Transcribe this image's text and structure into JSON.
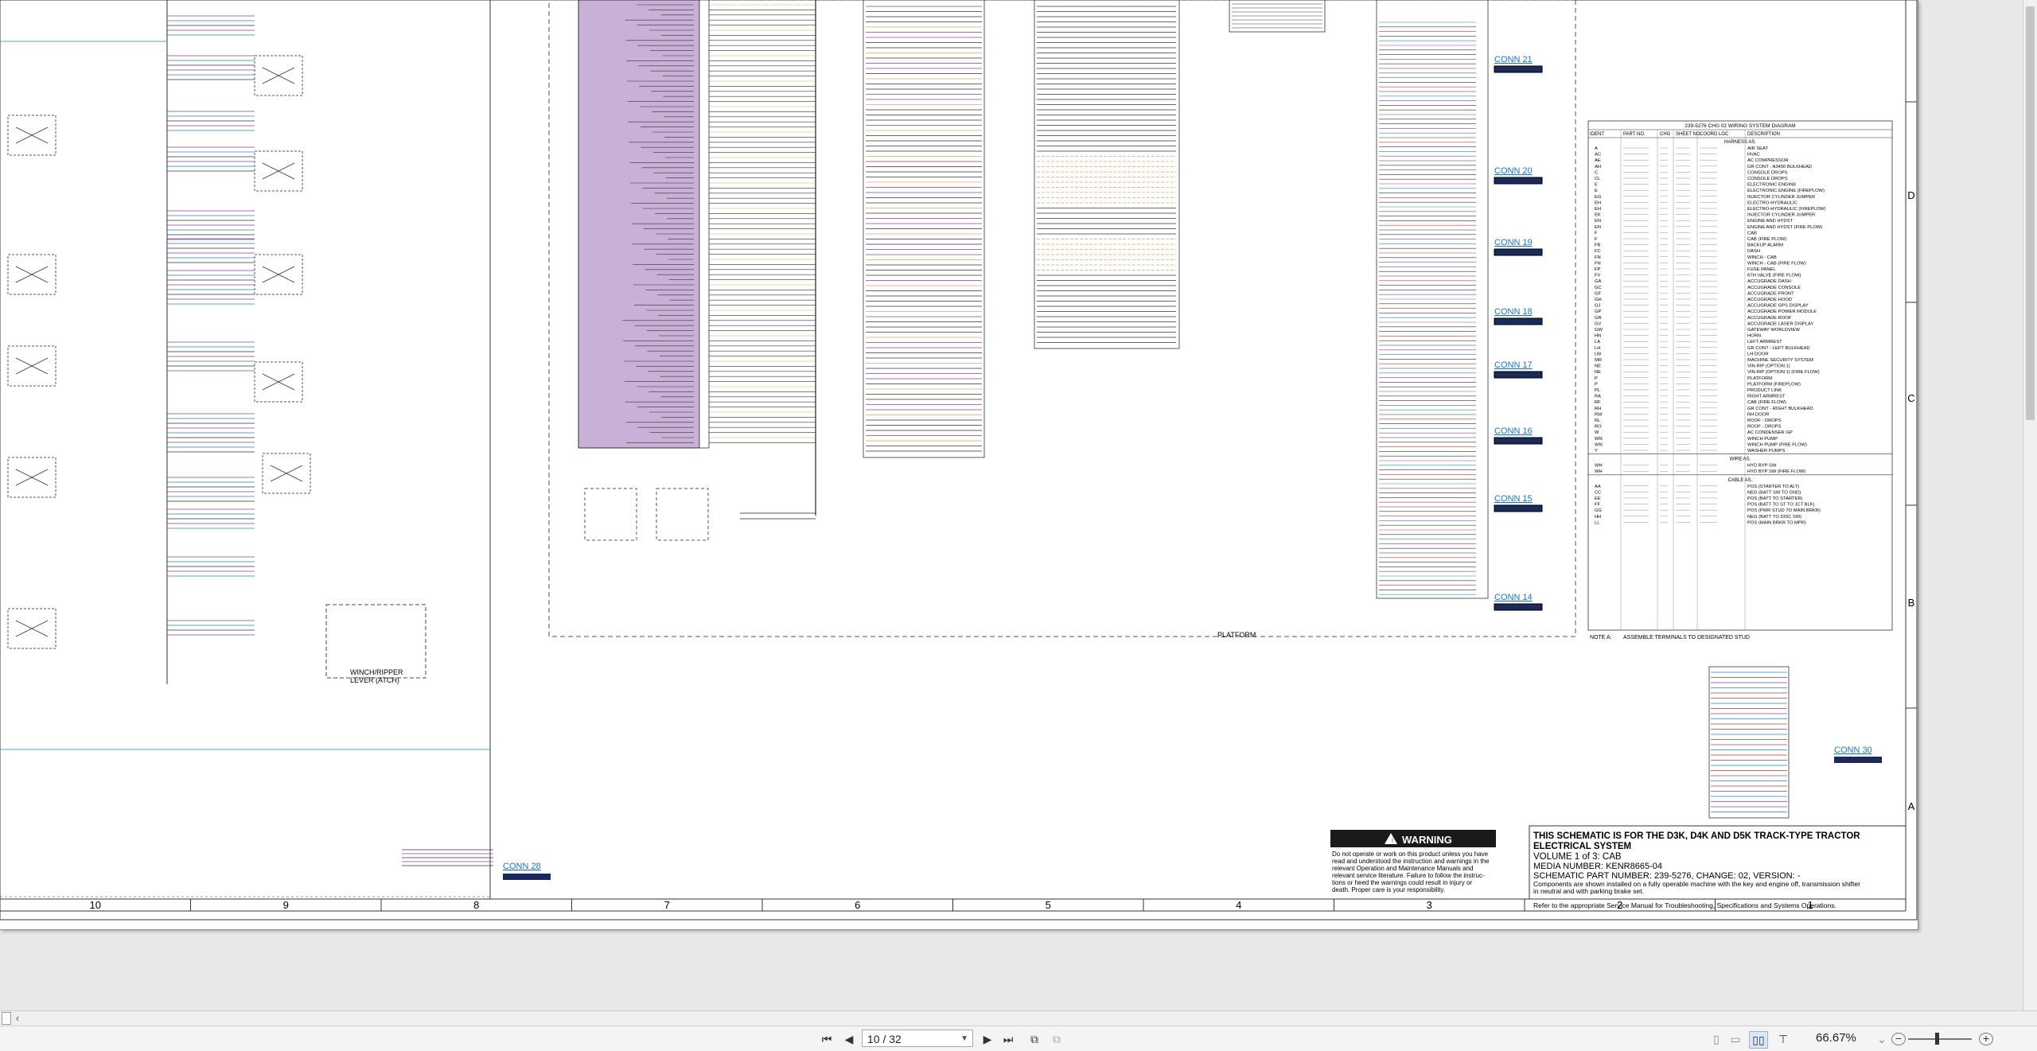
{
  "document": {
    "notice": {
      "line1": "THIS SCHEMATIC IS FOR THE D3K, D4K AND D5K TRACK-TYPE TRACTOR",
      "line2": "ELECTRICAL SYSTEM",
      "line3": "VOLUME 1 of 3: CAB",
      "line4": "MEDIA NUMBER: KENR8665-04",
      "line5": "SCHEMATIC PART NUMBER: 239-5276, CHANGE: 02, VERSION: -",
      "line6": "Components are shown installed on a fully operable machine with the key and engine off, transmission shifter",
      "line7": "in neutral and with parking brake set.",
      "line8": "Refer to the appropriate Service Manual for Troubleshooting, Specifications and Systems Operations."
    },
    "warning": {
      "title": "WARNING",
      "body1": "Do not operate or work on this product unless you have",
      "body2": "read and understood the instruction and warnings in the",
      "body3": "relevant Operation and Maintenance Manuals and",
      "body4": "relevant service literature. Failure to follow the instruc-",
      "body5": "tions or heed the warnings could result in injury or",
      "body6": "death. Proper care is your responsibility."
    },
    "column_numbers": [
      "10",
      "9",
      "8",
      "7",
      "6",
      "5",
      "4",
      "3",
      "2",
      "1"
    ],
    "row_letters": [
      "D",
      "C",
      "B",
      "A"
    ],
    "platform_label": "PLATFORM",
    "winch_label_1": "WINCH/RIPPER",
    "winch_label_2": "LEVER (ATCH)",
    "note_a": "NOTE A:",
    "note_a_text": "ASSEMBLE TERMINALS TO DESIGNATED STUD",
    "connectors": [
      {
        "id": "c21",
        "label": "CONN 21"
      },
      {
        "id": "c20",
        "label": "CONN 20"
      },
      {
        "id": "c19",
        "label": "CONN 19"
      },
      {
        "id": "c18",
        "label": "CONN 18"
      },
      {
        "id": "c17",
        "label": "CONN 17"
      },
      {
        "id": "c16",
        "label": "CONN 16"
      },
      {
        "id": "c15",
        "label": "CONN 15"
      },
      {
        "id": "c14",
        "label": "CONN 14"
      },
      {
        "id": "c30",
        "label": "CONN 30"
      },
      {
        "id": "c28",
        "label": "CONN 28"
      }
    ],
    "harness_table": {
      "title": "239-5276 CHG 02 WIRING SYSTEM DIAGRAM",
      "headers": [
        "IDENT",
        "PART NO.",
        "CHG",
        "SHEET NO.",
        "COORD LOC",
        "DESCRIPTION"
      ],
      "section_harness": "HARNESS AS.",
      "section_wire": "WIRE AS.",
      "section_cable": "CABLE AS.",
      "harness_rows": [
        [
          "A",
          "AIR SEAT"
        ],
        [
          "AC",
          "HVAC"
        ],
        [
          "AE",
          "AC COMPRESSOR"
        ],
        [
          "AH",
          "GR CONT - A3400 BULKHEAD"
        ],
        [
          "C",
          "CONSOLE DROPS"
        ],
        [
          "CL",
          "CONSOLE DROPS"
        ],
        [
          "E",
          "ELECTRONIC ENGINE"
        ],
        [
          "E",
          "ELECTRONIC ENGINE (FIREPLOW)"
        ],
        [
          "EG",
          "INJECTOR CYLINDER JUMPER"
        ],
        [
          "EH",
          "ELECTRO-HYDRAULIC"
        ],
        [
          "EH",
          "ELECTRO-HYDRAULIC (FIREPLOW)"
        ],
        [
          "EK",
          "INJECTOR CYLINDER JUMPER"
        ],
        [
          "EN",
          "ENGINE AND HYDST"
        ],
        [
          "EN",
          "ENGINE AND HYDST (FIRE PLOW)"
        ],
        [
          "F",
          "CAB"
        ],
        [
          "F",
          "CAB (FIRE PLOW)"
        ],
        [
          "FB",
          "BACKUP ALARM"
        ],
        [
          "FC",
          "DASH"
        ],
        [
          "FN",
          "WINCH - CAB"
        ],
        [
          "FN",
          "WINCH - CAB (FIRE FLOW)"
        ],
        [
          "FP",
          "FUSE PANEL"
        ],
        [
          "FV",
          "6TH VALVE (FIRE FLOW)"
        ],
        [
          "GA",
          "ACCUGRADE DASH"
        ],
        [
          "GC",
          "ACCUGRADE CONSOLE"
        ],
        [
          "GF",
          "ACCUGRADE FRONT"
        ],
        [
          "GH",
          "ACCUGRADE HOOD"
        ],
        [
          "GJ",
          "ACCUGRADE GPS DISPLAY"
        ],
        [
          "GP",
          "ACCUGRADE POWER MODULE"
        ],
        [
          "GR",
          "ACCUGRADE ROOF"
        ],
        [
          "GV",
          "ACCUGRADE LASER DISPLAY"
        ],
        [
          "GW",
          "GATEWAY WORLDVIEW"
        ],
        [
          "HN",
          "HORN"
        ],
        [
          "LA",
          "LEFT ARMREST"
        ],
        [
          "LH",
          "GR CONT - LEFT BULKHEAD"
        ],
        [
          "LW",
          "LH DOOR"
        ],
        [
          "MR",
          "MACHINE SECURITY SYSTEM"
        ],
        [
          "NE",
          "VIN-RIP (OPTION 1)"
        ],
        [
          "NE",
          "VIN-RIP (OPTION 1) (FIRE FLOW)"
        ],
        [
          "P",
          "PLATFORM"
        ],
        [
          "P",
          "PLATFORM (FIREPLOW)"
        ],
        [
          "PL",
          "PRODUCT LINK"
        ],
        [
          "RA",
          "RIGHT ARMREST"
        ],
        [
          "RF",
          "CAB (FIRE FLOW)"
        ],
        [
          "RH",
          "GR CONT - RIGHT BULKHEAD"
        ],
        [
          "RW",
          "RH DOOR"
        ],
        [
          "RL",
          "ROOF - DROPS"
        ],
        [
          "RO",
          "ROOF - DROPS"
        ],
        [
          "W",
          "AC CONDENSER GP"
        ],
        [
          "WN",
          "WINCH PUMP"
        ],
        [
          "WN",
          "WINCH PUMP (FIRE FLOW)"
        ],
        [
          "Y",
          "WASHER PUMPS"
        ]
      ],
      "wire_rows": [
        [
          "WH",
          "HYD BYP SW"
        ],
        [
          "WH",
          "HYD BYP SW (FIRE FLOW)"
        ]
      ],
      "cable_rows": [
        [
          "AA",
          "POS (STARTER TO ALT)"
        ],
        [
          "CC",
          "NEG (BATT SW TO GND)"
        ],
        [
          "EE",
          "POS (BATT TO STARTER)"
        ],
        [
          "FF",
          "POS (BATT TO ST TO JCT BLK)"
        ],
        [
          "GG",
          "POS (PWR STUD TO MAIN BRKR)"
        ],
        [
          "HH",
          "NEG (BATT TO DISC SW)"
        ],
        [
          "LL",
          "POS (MAIN BRKR TO MPR)"
        ]
      ]
    }
  },
  "viewer": {
    "page_indicator": "10 / 32",
    "zoom": "66.67%",
    "colors": {
      "purple_block": "#c9b0d6",
      "wire_purple": "#8b3f9a",
      "wire_blue": "#1e88c4",
      "wire_orange": "#e0a560",
      "wire_teal": "#2ea0a8",
      "link_blue": "#1a73c9",
      "dark": "#1a1a1a"
    }
  }
}
